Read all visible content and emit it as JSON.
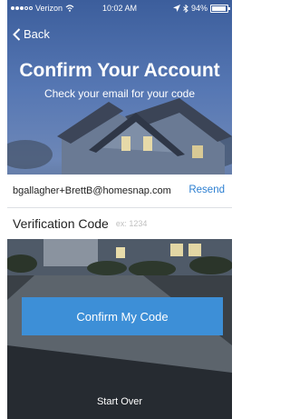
{
  "status_bar": {
    "carrier": "Verizon",
    "time": "10:02 AM",
    "battery": "94%",
    "battery_level": 0.94,
    "signal_bars_filled": 3,
    "signal_bars_total": 5
  },
  "nav": {
    "back_label": "Back"
  },
  "header": {
    "title": "Confirm Your Account",
    "subtitle": "Check your email for your code"
  },
  "form": {
    "email": "bgallagher+BrettB@homesnap.com",
    "resend_label": "Resend",
    "code_label": "Verification Code",
    "code_placeholder": "ex: 1234",
    "code_value": ""
  },
  "actions": {
    "confirm_label": "Confirm My Code",
    "start_over_label": "Start Over"
  },
  "colors": {
    "accent": "#3d8fd7",
    "link": "#2c7fd1"
  }
}
